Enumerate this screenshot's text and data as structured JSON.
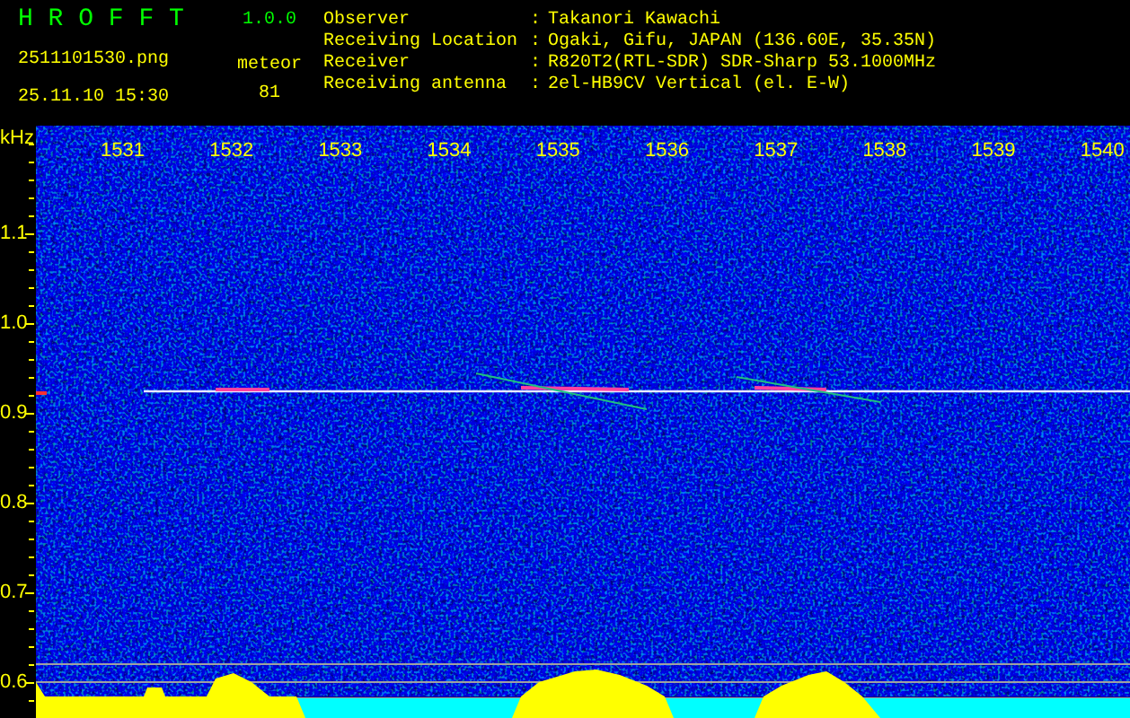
{
  "header": {
    "title": "H R O F F T",
    "version": "1.0.0",
    "filename": "2511101530.png",
    "datetime": "25.11.10 15:30",
    "count_label": "meteor",
    "count": "81",
    "info": [
      {
        "label": "Observer",
        "colon": ":",
        "value": "Takanori Kawachi"
      },
      {
        "label": "Receiving Location",
        "colon": ":",
        "value": "Ogaki, Gifu, JAPAN (136.60E, 35.35N)"
      },
      {
        "label": "Receiver",
        "colon": ":",
        "value": "R820T2(RTL-SDR) SDR-Sharp 53.1000MHz"
      },
      {
        "label": "Receiving antenna",
        "colon": ":",
        "value": "2el-HB9CV Vertical (el. E-W)"
      }
    ]
  },
  "plot": {
    "y_unit": "kHz",
    "y_labels": [
      "1.1",
      "1.0",
      "0.9",
      "0.8",
      "0.7",
      "0.6"
    ],
    "x_labels": [
      "1531",
      "1532",
      "1533",
      "1534",
      "1535",
      "1536",
      "1537",
      "1538",
      "1539",
      "1540"
    ]
  }
}
